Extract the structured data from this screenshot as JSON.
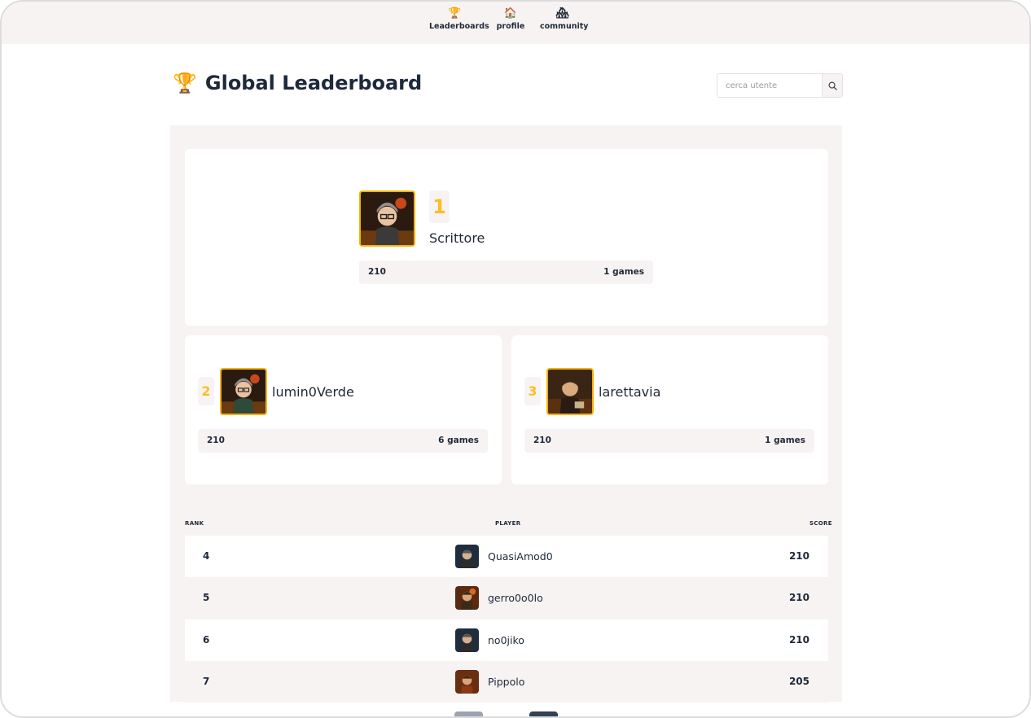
{
  "nav": [
    {
      "label": "Leaderboards",
      "icon": "trophy-icon"
    },
    {
      "label": "profile",
      "icon": "house-icon"
    },
    {
      "label": "community",
      "icon": "community-icon"
    }
  ],
  "page": {
    "title": "Global Leaderboard",
    "title_icon": "trophy-icon"
  },
  "search": {
    "placeholder": "cerca utente",
    "button_icon": "search-icon"
  },
  "podium": [
    {
      "rank": "1",
      "name": "Scrittore",
      "score": "210",
      "games": "1 games"
    },
    {
      "rank": "2",
      "name": "lumin0Verde",
      "score": "210",
      "games": "6 games"
    },
    {
      "rank": "3",
      "name": "larettavia",
      "score": "210",
      "games": "1 games"
    }
  ],
  "table": {
    "headers": {
      "rank": "RANK",
      "player": "PLAYER",
      "score": "SCORE"
    },
    "rows": [
      {
        "rank": "4",
        "name": "QuasiAmod0",
        "score": "210"
      },
      {
        "rank": "5",
        "name": "gerro0o0lo",
        "score": "210"
      },
      {
        "rank": "6",
        "name": "no0jiko",
        "score": "210"
      },
      {
        "rank": "7",
        "name": "Pippolo",
        "score": "205"
      }
    ]
  },
  "colors": {
    "accent_gold": "#fbbf24",
    "panel_bg": "#f8f3f3",
    "heading": "#1e293b"
  }
}
